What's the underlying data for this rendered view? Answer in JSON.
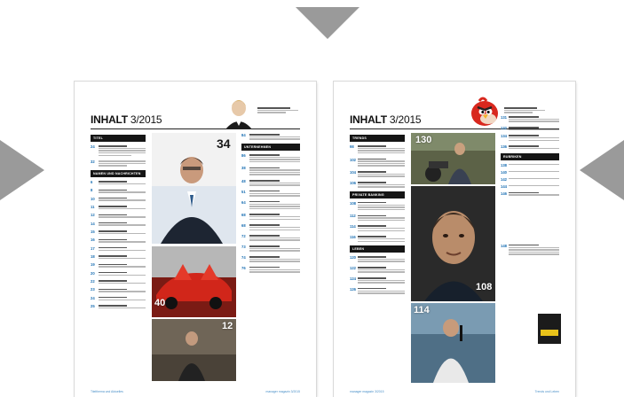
{
  "navigation": {
    "prev": "arrow-left-icon",
    "next": "arrow-right-icon",
    "up": "arrow-up-icon"
  },
  "left_page": {
    "title_bold": "INHALT",
    "issue": "3/2015",
    "sections": [
      "TITEL",
      "NAMEN UND NACHRICHTEN"
    ],
    "right_sections": [
      "UNTERNEHMEN"
    ],
    "entries_left": [
      "24",
      "32",
      "6",
      "8",
      "10",
      "11",
      "12",
      "14",
      "15",
      "16",
      "17",
      "18",
      "19",
      "20",
      "22",
      "23",
      "24",
      "25",
      "26",
      "27",
      "28"
    ],
    "entries_right": [
      "84",
      "86",
      "38",
      "48",
      "51",
      "64",
      "68",
      "68",
      "72",
      "73",
      "74",
      "76",
      "77",
      "80"
    ],
    "photo_numbers": [
      "34",
      "40",
      "12"
    ],
    "footer_left": "Titelthema und Aktuelles",
    "footer_right": "manager magazin 3/2015"
  },
  "right_page": {
    "title_bold": "INHALT",
    "issue": "3/2015",
    "sections": [
      "TRENDS",
      "PRIVATE BANKING",
      "LEBEN"
    ],
    "right_sections": [
      "RUBRIKEN"
    ],
    "entries_left": [
      "98",
      "102",
      "104",
      "106",
      "108",
      "112",
      "114",
      "116",
      "120",
      "122",
      "124",
      "126",
      "128",
      "130"
    ],
    "entries_right": [
      "131",
      "132",
      "134",
      "136",
      "138",
      "140",
      "142",
      "144",
      "146",
      "148",
      "150"
    ],
    "photo_numbers": [
      "130",
      "108",
      "114"
    ],
    "footer_left": "manager magazin 3/2015",
    "footer_right": "Trends und Leben"
  },
  "colors": {
    "accent": "#1a6fb3",
    "arrow": "#9a9a9a",
    "section": "#151515"
  }
}
